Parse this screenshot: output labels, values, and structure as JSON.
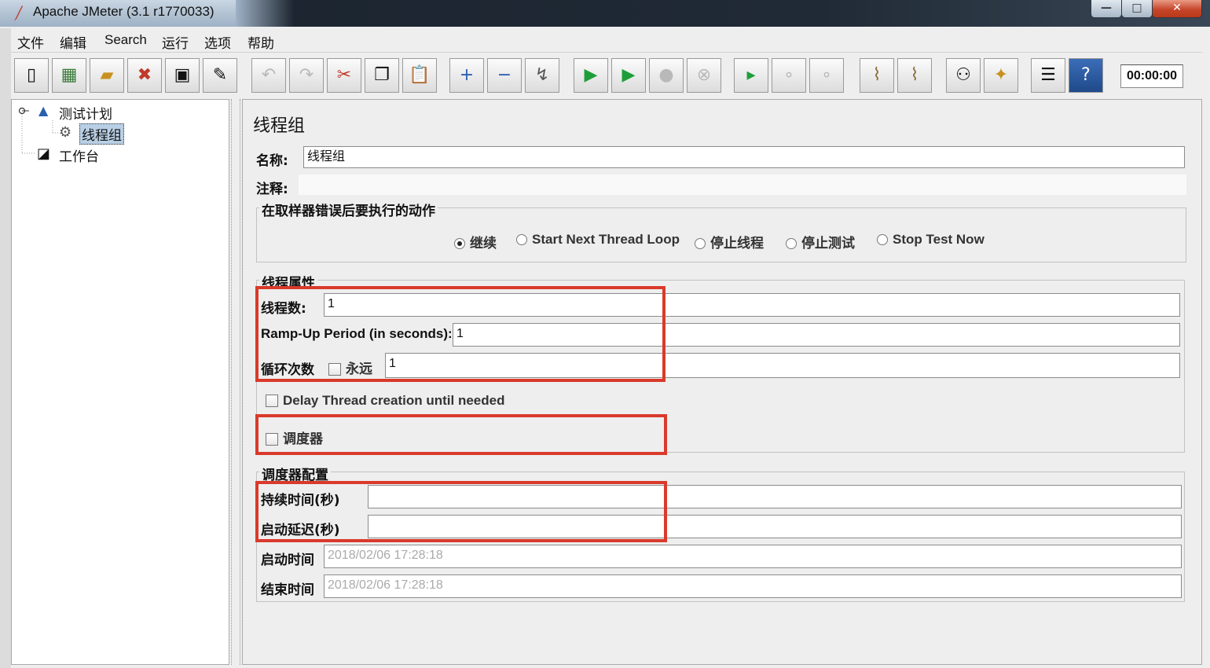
{
  "window": {
    "title": "Apache JMeter (3.1 r1770033)",
    "minimize": "—",
    "maximize": "□",
    "close": "✕"
  },
  "menu": [
    "文件",
    "编辑",
    "Search",
    "运行",
    "选项",
    "帮助"
  ],
  "toolbar": {
    "timer": "00:00:00"
  },
  "tree": {
    "plan": "测试计划",
    "thread_group": "线程组",
    "workbench": "工作台"
  },
  "panel": {
    "title": "线程组",
    "name_label": "名称:",
    "name_value": "线程组",
    "comment_label": "注释:",
    "comment_value": "",
    "error_action": {
      "legend": "在取样器错误后要执行的动作",
      "options": [
        "继续",
        "Start Next Thread Loop",
        "停止线程",
        "停止测试",
        "Stop Test Now"
      ],
      "selected": "继续"
    },
    "thread_props": {
      "legend": "线程属性",
      "threads_label": "线程数:",
      "threads_value": "1",
      "rampup_label": "Ramp-Up Period (in seconds):",
      "rampup_value": "1",
      "loop_label": "循环次数",
      "forever_label": "永远",
      "loop_value": "1",
      "delay_label": "Delay Thread creation until needed",
      "scheduler_label": "调度器"
    },
    "scheduler": {
      "legend": "调度器配置",
      "duration_label": "持续时间(秒)",
      "duration_value": "",
      "delay_label": "启动延迟(秒)",
      "delay_value": "",
      "start_label": "启动时间",
      "start_value": "2018/02/06 17:28:18",
      "end_label": "结束时间",
      "end_value": "2018/02/06 17:28:18"
    }
  },
  "colors": {
    "highlight": "#d93a2b",
    "selection": "#b8cfe5"
  }
}
